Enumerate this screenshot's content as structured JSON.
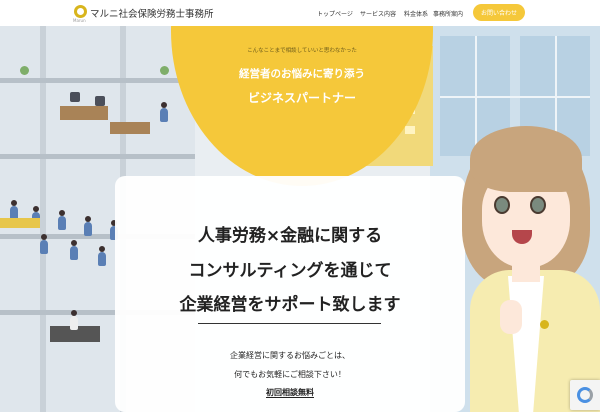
{
  "header": {
    "site_name": "マルニ社会保険労務士事務所",
    "logo_sub": "Marun",
    "nav": [
      "トップページ",
      "サービス内容",
      "料金体系",
      "事務所案内"
    ],
    "contact_label": "お問い合わせ",
    "accent_color": "#f5c83a"
  },
  "hero": {
    "tagline_small": "こんなことまで相談していいと思わなかった",
    "tagline_1": "経営者のお悩みに寄り添う",
    "tagline_2": "ビジネスパートナー",
    "headlines": [
      "人事労務×金融に関する",
      "コンサルティングを通じて",
      "企業経営をサポート致します"
    ],
    "sub_1": "企業経営に関するお悩みごとは、",
    "sub_2": "何でもお気軽にご相談下さい！",
    "consult_link": "初回相談無料"
  },
  "icons": {
    "logo": "logo-icon",
    "recaptcha": "recaptcha-icon"
  }
}
